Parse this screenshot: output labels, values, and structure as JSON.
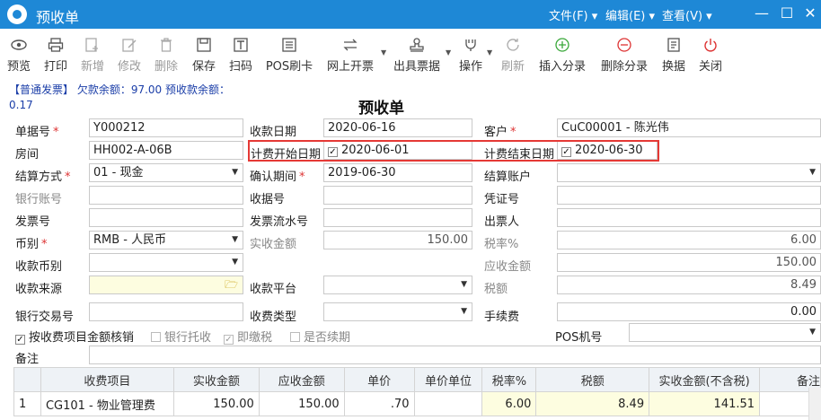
{
  "window": {
    "title": "预收单",
    "menus": [
      "文件(F)",
      "编辑(E)",
      "查看(V)"
    ]
  },
  "toolbar": {
    "items": [
      {
        "label": "预览",
        "icon": "eye-icon",
        "enabled": true
      },
      {
        "label": "打印",
        "icon": "printer-icon",
        "enabled": true
      },
      {
        "label": "新增",
        "icon": "add-icon",
        "enabled": false
      },
      {
        "label": "修改",
        "icon": "edit-icon",
        "enabled": false
      },
      {
        "label": "删除",
        "icon": "trash-icon",
        "enabled": false
      },
      {
        "label": "保存",
        "icon": "save-icon",
        "enabled": true
      },
      {
        "label": "扫码",
        "icon": "scan-icon",
        "enabled": true
      },
      {
        "label": "POS刷卡",
        "icon": "pos-icon",
        "enabled": true
      },
      {
        "label": "网上开票",
        "icon": "transfer-icon",
        "enabled": true
      },
      {
        "label": "出具票据",
        "icon": "stamp-icon",
        "enabled": true
      },
      {
        "label": "操作",
        "icon": "operate-icon",
        "enabled": true
      },
      {
        "label": "刷新",
        "icon": "refresh-icon",
        "enabled": false
      },
      {
        "label": "插入分录",
        "icon": "plus-circle-icon",
        "enabled": true
      },
      {
        "label": "删除分录",
        "icon": "minus-circle-icon",
        "enabled": true
      },
      {
        "label": "换据",
        "icon": "doc-icon",
        "enabled": true
      },
      {
        "label": "关闭",
        "icon": "power-icon",
        "enabled": true
      }
    ]
  },
  "info": {
    "text": "【普通发票】 欠款余额：97.00 预收款余额：",
    "balance": "0.17"
  },
  "doc_title": "预收单",
  "form": {
    "bill_no_label": "单据号",
    "bill_no": "Y000212",
    "receipt_date_label": "收款日期",
    "receipt_date": "2020-06-16",
    "customer_label": "客户",
    "customer": "CuC00001 - 陈光伟",
    "room_label": "房间",
    "room": "HH002-A-06B",
    "start_date_label": "计费开始日期",
    "start_date": "2020-06-01",
    "end_date_label": "计费结束日期",
    "end_date": "2020-06-30",
    "settle_label": "结算方式",
    "settle": "01 - 现金",
    "confirm_period_label": "确认期间",
    "confirm_period": "2019-06-30",
    "settle_account_label": "结算账户",
    "settle_account": "",
    "bank_account_label": "银行账号",
    "bank_account": "",
    "receipt_no_label": "收据号",
    "receipt_no": "",
    "voucher_no_label": "凭证号",
    "voucher_no": "",
    "invoice_no_label": "发票号",
    "invoice_no": "",
    "invoice_serial_label": "发票流水号",
    "invoice_serial": "",
    "drawer_label": "出票人",
    "drawer": "",
    "currency_label": "币别",
    "currency": "RMB - 人民币",
    "actual_amount_label": "实收金额",
    "actual_amount": "150.00",
    "tax_rate_label": "税率%",
    "tax_rate": "6.00",
    "receipt_currency_label": "收款币别",
    "receipt_currency": "",
    "receivable_label": "应收金额",
    "receivable": "150.00",
    "source_label": "收款来源",
    "source": "",
    "platform_label": "收款平台",
    "platform": "",
    "tax_label": "税额",
    "tax": "8.49",
    "bank_txn_label": "银行交易号",
    "bank_txn": "",
    "receipt_type_label": "收费类型",
    "receipt_type": "",
    "fee_label": "手续费",
    "fee": "0.00",
    "check_verify_label": "按收费项目金额核销",
    "check_bank_label": "银行托收",
    "check_instant_label": "即缴税",
    "check_renew_label": "是否续期",
    "pos_label": "POS机号",
    "pos": "",
    "remark_label": "备注",
    "remark": ""
  },
  "grid": {
    "headers": [
      "收费项目",
      "实收金额",
      "应收金额",
      "单价",
      "单价单位",
      "税率%",
      "税额",
      "实收金额(不含税)",
      "备注"
    ],
    "rows": [
      {
        "no": "1",
        "item": "CG101 - 物业管理费",
        "actual": "150.00",
        "receivable": "150.00",
        "price": ".70",
        "unit": "",
        "rate": "6.00",
        "tax": "8.49",
        "net": "141.51",
        "remark": ""
      }
    ]
  },
  "colors": {
    "titlebar": "#1e88d6",
    "highlight_box": "#e53935",
    "info_text": "#1b3ea8"
  }
}
